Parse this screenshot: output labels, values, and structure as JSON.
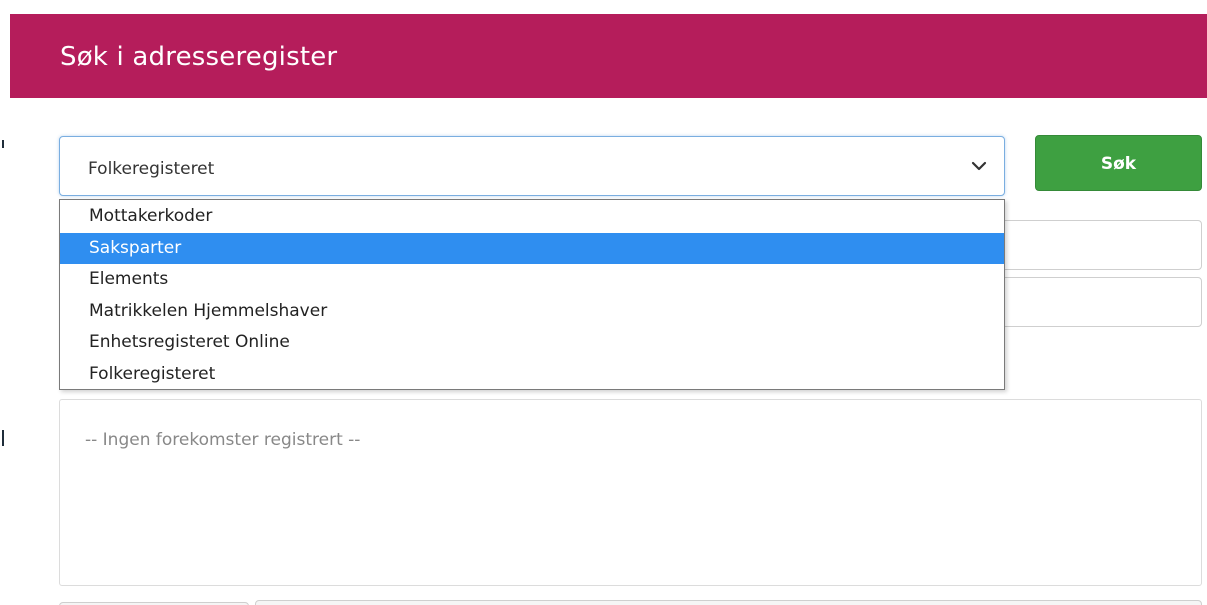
{
  "dialog": {
    "title": "Søk i adresseregister"
  },
  "registry_select": {
    "value": "Folkeregisteret",
    "options": [
      "Mottakerkoder",
      "Saksparter",
      "Elements",
      "Matrikkelen Hjemmelshaver",
      "Enhetsregisteret Online",
      "Folkeregisteret"
    ],
    "highlighted_option": "Saksparter"
  },
  "search_button": {
    "label": "Søk"
  },
  "results": {
    "empty_text": "-- Ingen forekomster registrert --"
  },
  "colors": {
    "header": "#b51d5b",
    "button": "#3ea041",
    "highlight": "#2f8ef0"
  },
  "icons": {
    "select_chevron": "chevron-down-icon"
  }
}
